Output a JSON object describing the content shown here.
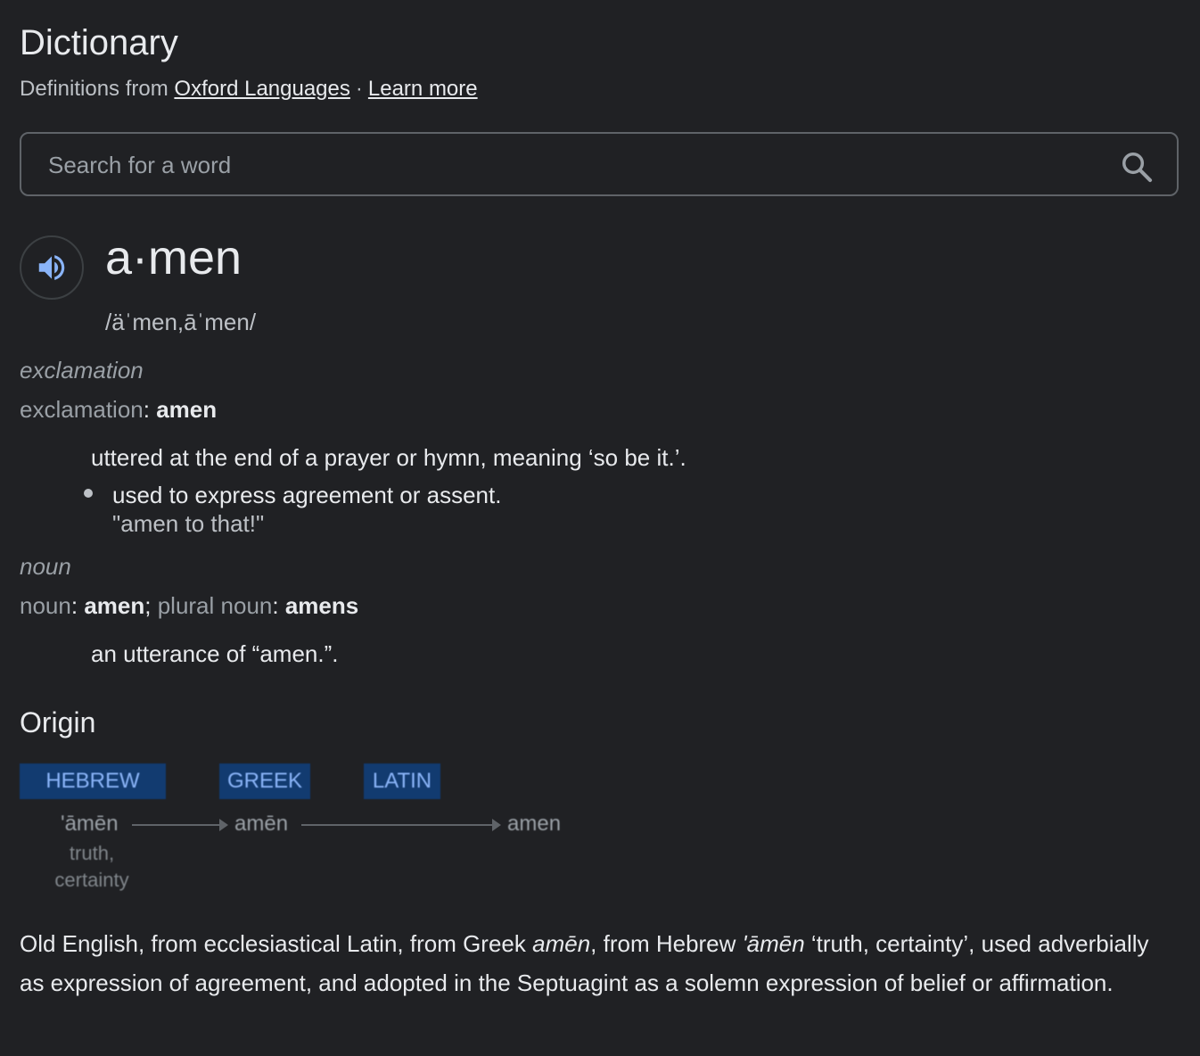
{
  "header": {
    "title": "Dictionary",
    "subtitle_prefix": "Definitions from",
    "source_link": "Oxford Languages",
    "separator": "·",
    "learn_more": "Learn more"
  },
  "search": {
    "placeholder": "Search for a word",
    "value": "",
    "icon": "search-icon"
  },
  "entry": {
    "speaker_icon": "speaker-icon",
    "word": "a·men",
    "phonetic": "/äˈmen,āˈmen/",
    "senses": [
      {
        "pos": "exclamation",
        "inflection_label": "exclamation",
        "inflection_word": "amen",
        "definition": "uttered at the end of a prayer or hymn, meaning ‘so be it.’.",
        "sub_definition": "used to express agreement or assent.",
        "example": "\"amen to that!\""
      },
      {
        "pos": "noun",
        "inflection_label": "noun",
        "inflection_word": "amen",
        "plural_label": "plural noun",
        "plural_word": "amens",
        "definition": "an utterance of “amen.”."
      }
    ]
  },
  "origin": {
    "heading": "Origin",
    "languages": [
      "HEBREW",
      "GREEK",
      "LATIN"
    ],
    "forms": [
      "ʹāmēn",
      "amēn",
      "amen"
    ],
    "gloss_line1": "truth,",
    "gloss_line2": "certainty",
    "text_1": "Old English, from ecclesiastical Latin, from Greek ",
    "text_em1": "amēn",
    "text_2": ", from Hebrew ",
    "text_em2": "ʹāmēn",
    "text_3": " ‘truth, certainty’, used adverbially as expression of agreement, and adopted in the Septuagint as a solemn expression of belief or affirmation."
  },
  "colors": {
    "background": "#202124",
    "accent": "#8ab4f8",
    "origin_tag_bg": "#123b70"
  }
}
